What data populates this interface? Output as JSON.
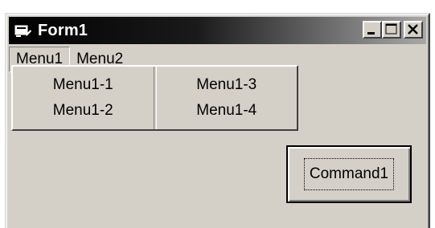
{
  "window": {
    "title": "Form1"
  },
  "menubar": {
    "items": [
      {
        "label": "Menu1"
      },
      {
        "label": "Menu2"
      }
    ]
  },
  "dropdown": {
    "columns": [
      [
        "Menu1-1",
        "Menu1-2"
      ],
      [
        "Menu1-3",
        "Menu1-4"
      ]
    ]
  },
  "command_button": {
    "label": "Command1"
  }
}
